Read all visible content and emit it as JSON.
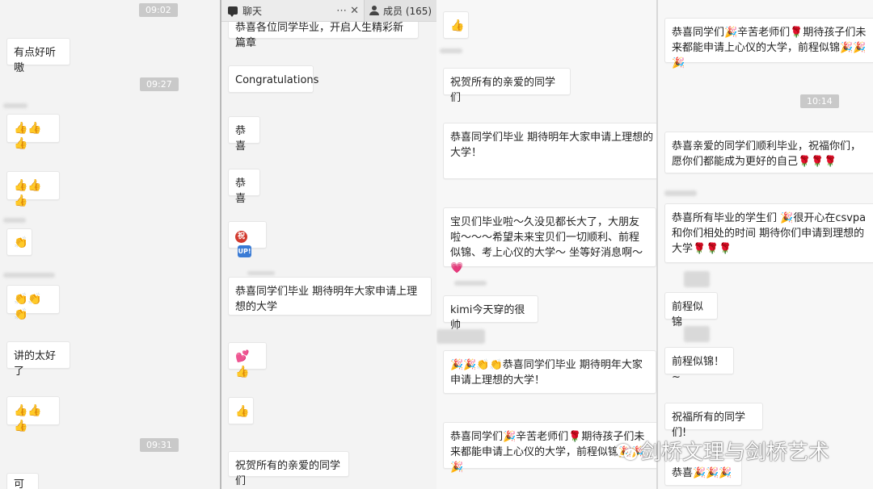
{
  "col1": {
    "times": [
      "09:02",
      "09:27",
      "09:31"
    ],
    "messages": [
      "有点好听嗷",
      "👍👍👍",
      "👍👍👍",
      "👏",
      "👏👏👏",
      "讲的太好了",
      "👍👍👍",
      "可以"
    ]
  },
  "col2": {
    "header": {
      "title": "聊天",
      "more_icon": "ellipsis-icon",
      "close_icon": "close-icon",
      "members_label": "成员 (165)"
    },
    "messages": [
      "恭喜各位同学毕业，开启人生精彩新篇章",
      "Congratulations",
      "恭喜",
      "恭喜",
      "恭喜同学们毕业 期待明年大家申请上理想的大学",
      "💕👍",
      "👍",
      "祝贺所有的亲爱的同学们"
    ],
    "badge_zhu": "祝",
    "badge_up": "UP!"
  },
  "col3": {
    "messages": [
      "👍",
      "祝贺所有的亲爱的同学们",
      "恭喜同学们毕业 期待明年大家申请上理想的大学！",
      "宝贝们毕业啦～久没见都长大了，大朋友啦～～～希望未来宝贝们一切顺利、前程似锦、考上心仪的大学～ 坐等好消息啊～💗",
      "kimi今天穿的很帅",
      "🎉🎉👏👏恭喜同学们毕业 期待明年大家申请上理想的大学！",
      "恭喜同学们🎉辛苦老师们🌹期待孩子们未来都能申请上心仪的大学，前程似锦🎉🎉🎉"
    ]
  },
  "col4": {
    "time": "10:14",
    "messages": [
      "恭喜同学们🎉辛苦老师们🌹期待孩子们未来都能申请上心仪的大学，前程似锦🎉🎉🎉",
      "恭喜亲爱的同学们顺利毕业，祝福你们，愿你们都能成为更好的自己🌹🌹🌹",
      "恭喜所有毕业的学生们 🎉很开心在csvpa和你们相处的时间 期待你们申请到理想的大学🌹🌹🌹",
      "前程似锦",
      "前程似锦！~",
      "祝福所有的同学们!",
      "恭喜🎉🎉🎉"
    ]
  },
  "watermark": "剑桥文理与剑桥艺术"
}
